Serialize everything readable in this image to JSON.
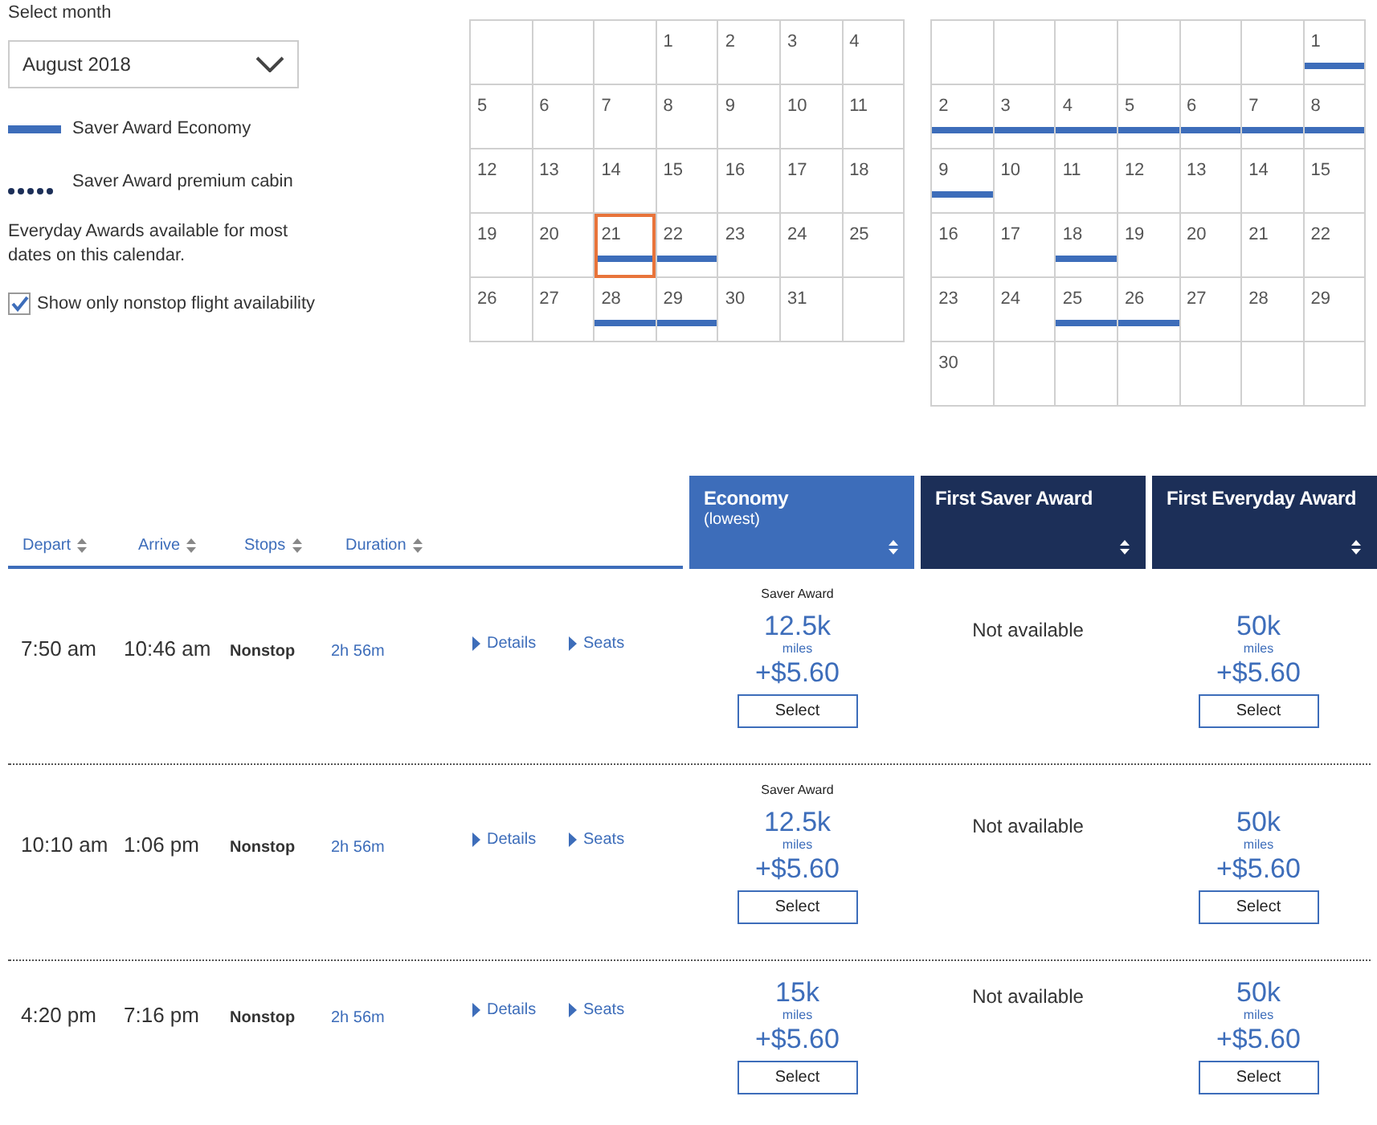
{
  "month_select": {
    "label": "Select month",
    "value": "August 2018"
  },
  "legend": [
    {
      "kind": "bar",
      "label": "Saver Award Economy"
    },
    {
      "kind": "dots",
      "label": "Saver Award premium cabin"
    }
  ],
  "note": "Everyday Awards available for most dates on this calendar.",
  "nonstop_filter": {
    "label": "Show only nonstop flight availability",
    "checked": true
  },
  "calendars": [
    {
      "weeks": [
        [
          {
            "kind": "blank"
          },
          {
            "kind": "blank"
          },
          {
            "kind": "blank"
          },
          {
            "kind": "day",
            "day": "1",
            "saver": false,
            "selected": false
          },
          {
            "kind": "day",
            "day": "2",
            "saver": false,
            "selected": false
          },
          {
            "kind": "day",
            "day": "3",
            "saver": false,
            "selected": false
          },
          {
            "kind": "day",
            "day": "4",
            "saver": false,
            "selected": false
          }
        ],
        [
          {
            "kind": "day",
            "day": "5",
            "saver": false,
            "selected": false
          },
          {
            "kind": "day",
            "day": "6",
            "saver": false,
            "selected": false
          },
          {
            "kind": "day",
            "day": "7",
            "saver": false,
            "selected": false
          },
          {
            "kind": "day",
            "day": "8",
            "saver": false,
            "selected": false
          },
          {
            "kind": "day",
            "day": "9",
            "saver": false,
            "selected": false
          },
          {
            "kind": "day",
            "day": "10",
            "saver": false,
            "selected": false
          },
          {
            "kind": "day",
            "day": "11",
            "saver": false,
            "selected": false
          }
        ],
        [
          {
            "kind": "day",
            "day": "12",
            "saver": false,
            "selected": false
          },
          {
            "kind": "day",
            "day": "13",
            "saver": false,
            "selected": false
          },
          {
            "kind": "day",
            "day": "14",
            "saver": false,
            "selected": false
          },
          {
            "kind": "day",
            "day": "15",
            "saver": false,
            "selected": false
          },
          {
            "kind": "day",
            "day": "16",
            "saver": false,
            "selected": false
          },
          {
            "kind": "day",
            "day": "17",
            "saver": false,
            "selected": false
          },
          {
            "kind": "day",
            "day": "18",
            "saver": false,
            "selected": false
          }
        ],
        [
          {
            "kind": "day",
            "day": "19",
            "saver": false,
            "selected": false
          },
          {
            "kind": "day",
            "day": "20",
            "saver": false,
            "selected": false
          },
          {
            "kind": "day",
            "day": "21",
            "saver": true,
            "selected": true
          },
          {
            "kind": "day",
            "day": "22",
            "saver": true,
            "selected": false
          },
          {
            "kind": "day",
            "day": "23",
            "saver": false,
            "selected": false
          },
          {
            "kind": "day",
            "day": "24",
            "saver": false,
            "selected": false
          },
          {
            "kind": "day",
            "day": "25",
            "saver": false,
            "selected": false
          }
        ],
        [
          {
            "kind": "day",
            "day": "26",
            "saver": false,
            "selected": false
          },
          {
            "kind": "day",
            "day": "27",
            "saver": false,
            "selected": false
          },
          {
            "kind": "day",
            "day": "28",
            "saver": true,
            "selected": false
          },
          {
            "kind": "day",
            "day": "29",
            "saver": true,
            "selected": false
          },
          {
            "kind": "day",
            "day": "30",
            "saver": false,
            "selected": false
          },
          {
            "kind": "day",
            "day": "31",
            "saver": false,
            "selected": false
          },
          {
            "kind": "blank"
          }
        ]
      ]
    },
    {
      "weeks": [
        [
          {
            "kind": "blank"
          },
          {
            "kind": "blank"
          },
          {
            "kind": "blank"
          },
          {
            "kind": "blank"
          },
          {
            "kind": "blank"
          },
          {
            "kind": "blank"
          },
          {
            "kind": "day",
            "day": "1",
            "saver": true,
            "selected": false
          }
        ],
        [
          {
            "kind": "day",
            "day": "2",
            "saver": true,
            "selected": false
          },
          {
            "kind": "day",
            "day": "3",
            "saver": true,
            "selected": false
          },
          {
            "kind": "day",
            "day": "4",
            "saver": true,
            "selected": false
          },
          {
            "kind": "day",
            "day": "5",
            "saver": true,
            "selected": false
          },
          {
            "kind": "day",
            "day": "6",
            "saver": true,
            "selected": false
          },
          {
            "kind": "day",
            "day": "7",
            "saver": true,
            "selected": false
          },
          {
            "kind": "day",
            "day": "8",
            "saver": true,
            "selected": false
          }
        ],
        [
          {
            "kind": "day",
            "day": "9",
            "saver": true,
            "selected": false
          },
          {
            "kind": "day",
            "day": "10",
            "saver": false,
            "selected": false
          },
          {
            "kind": "day",
            "day": "11",
            "saver": false,
            "selected": false
          },
          {
            "kind": "day",
            "day": "12",
            "saver": false,
            "selected": false
          },
          {
            "kind": "day",
            "day": "13",
            "saver": false,
            "selected": false
          },
          {
            "kind": "day",
            "day": "14",
            "saver": false,
            "selected": false
          },
          {
            "kind": "day",
            "day": "15",
            "saver": false,
            "selected": false
          }
        ],
        [
          {
            "kind": "day",
            "day": "16",
            "saver": false,
            "selected": false
          },
          {
            "kind": "day",
            "day": "17",
            "saver": false,
            "selected": false
          },
          {
            "kind": "day",
            "day": "18",
            "saver": true,
            "selected": false
          },
          {
            "kind": "day",
            "day": "19",
            "saver": false,
            "selected": false
          },
          {
            "kind": "day",
            "day": "20",
            "saver": false,
            "selected": false
          },
          {
            "kind": "day",
            "day": "21",
            "saver": false,
            "selected": false
          },
          {
            "kind": "day",
            "day": "22",
            "saver": false,
            "selected": false
          }
        ],
        [
          {
            "kind": "day",
            "day": "23",
            "saver": false,
            "selected": false
          },
          {
            "kind": "day",
            "day": "24",
            "saver": false,
            "selected": false
          },
          {
            "kind": "day",
            "day": "25",
            "saver": true,
            "selected": false
          },
          {
            "kind": "day",
            "day": "26",
            "saver": true,
            "selected": false
          },
          {
            "kind": "day",
            "day": "27",
            "saver": false,
            "selected": false
          },
          {
            "kind": "day",
            "day": "28",
            "saver": false,
            "selected": false
          },
          {
            "kind": "day",
            "day": "29",
            "saver": false,
            "selected": false
          }
        ],
        [
          {
            "kind": "day",
            "day": "30",
            "saver": false,
            "selected": false
          },
          {
            "kind": "blank"
          },
          {
            "kind": "blank"
          },
          {
            "kind": "blank"
          },
          {
            "kind": "blank"
          },
          {
            "kind": "blank"
          },
          {
            "kind": "blank"
          }
        ]
      ]
    }
  ],
  "columns": [
    "Depart",
    "Arrive",
    "Stops",
    "Duration"
  ],
  "fare_columns": [
    {
      "title": "Economy",
      "subtitle": "(lowest)",
      "selected": true
    },
    {
      "title": "First Saver Award",
      "selected": false
    },
    {
      "title": "First Everyday Award",
      "selected": false
    }
  ],
  "flights": [
    {
      "depart": "7:50 am",
      "arrive": "10:46 am",
      "stops": "Nonstop",
      "duration": "2h 56m",
      "links": [
        "Details",
        "Seats"
      ],
      "fares": [
        {
          "kind": "offer",
          "tag": "Saver Award",
          "miles": "12.5k",
          "unit": "miles",
          "price": "+$5.60",
          "button": "Select"
        },
        {
          "kind": "unavailable",
          "text": "Not available"
        },
        {
          "kind": "offer",
          "miles": "50k",
          "unit": "miles",
          "price": "+$5.60",
          "button": "Select"
        }
      ]
    },
    {
      "depart": "10:10 am",
      "arrive": "1:06 pm",
      "stops": "Nonstop",
      "duration": "2h 56m",
      "links": [
        "Details",
        "Seats"
      ],
      "fares": [
        {
          "kind": "offer",
          "tag": "Saver Award",
          "miles": "12.5k",
          "unit": "miles",
          "price": "+$5.60",
          "button": "Select"
        },
        {
          "kind": "unavailable",
          "text": "Not available"
        },
        {
          "kind": "offer",
          "miles": "50k",
          "unit": "miles",
          "price": "+$5.60",
          "button": "Select"
        }
      ]
    },
    {
      "depart": "4:20 pm",
      "arrive": "7:16 pm",
      "stops": "Nonstop",
      "duration": "2h 56m",
      "links": [
        "Details",
        "Seats"
      ],
      "fares": [
        {
          "kind": "offer",
          "miles": "15k",
          "unit": "miles",
          "price": "+$5.60",
          "button": "Select"
        },
        {
          "kind": "unavailable",
          "text": "Not available"
        },
        {
          "kind": "offer",
          "miles": "50k",
          "unit": "miles",
          "price": "+$5.60",
          "button": "Select"
        }
      ]
    }
  ]
}
